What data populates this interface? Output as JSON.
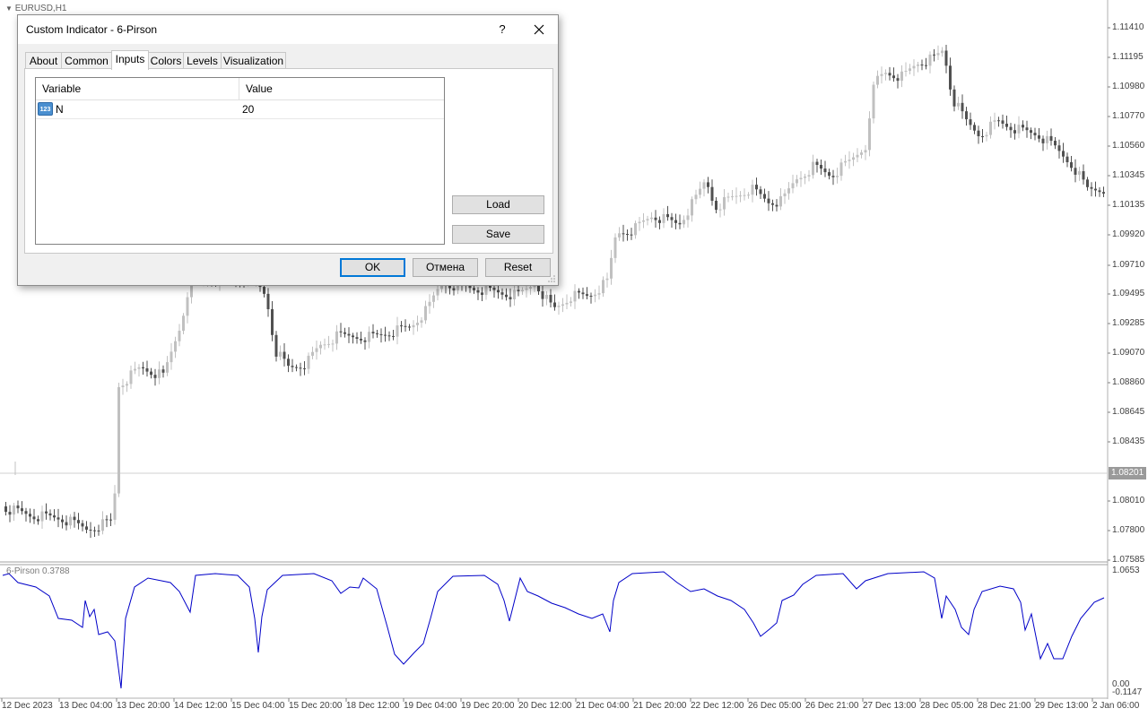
{
  "chart": {
    "symbol_label": "EURUSD,H1",
    "indicator_label": "6-Pirson 0.3788",
    "current_price": "1.08201",
    "price_axis": [
      "1.11410",
      "1.11195",
      "1.10980",
      "1.10770",
      "1.10560",
      "1.10345",
      "1.10135",
      "1.09920",
      "1.09710",
      "1.09495",
      "1.09285",
      "1.09070",
      "1.08860",
      "1.08645",
      "1.08435",
      "1.08010",
      "1.07800",
      "1.07585"
    ],
    "indicator_axis": [
      "1.0653",
      "0.00",
      "-0.1147"
    ],
    "time_axis": [
      "12 Dec 2023",
      "13 Dec 04:00",
      "13 Dec 20:00",
      "14 Dec 12:00",
      "15 Dec 04:00",
      "15 Dec 20:00",
      "18 Dec 12:00",
      "19 Dec 04:00",
      "19 Dec 20:00",
      "20 Dec 12:00",
      "21 Dec 04:00",
      "21 Dec 20:00",
      "22 Dec 12:00",
      "26 Dec 05:00",
      "26 Dec 21:00",
      "27 Dec 13:00",
      "28 Dec 05:00",
      "28 Dec 21:00",
      "29 Dec 13:00",
      "2 Jan 06:00"
    ],
    "colors": {
      "bull": "#c0c0c0",
      "bear": "#505050",
      "indicator_line": "#0000c8",
      "grid": "#c8c8c8"
    }
  },
  "dialog": {
    "title": "Custom Indicator - 6-Pirson",
    "help_label": "?",
    "tabs": [
      {
        "label": "About"
      },
      {
        "label": "Common"
      },
      {
        "label": "Inputs"
      },
      {
        "label": "Colors"
      },
      {
        "label": "Levels"
      },
      {
        "label": "Visualization"
      }
    ],
    "active_tab": "Inputs",
    "inputs_table": {
      "headers": [
        "Variable",
        "Value"
      ],
      "rows": [
        {
          "icon_text": "123",
          "variable": "N",
          "value": "20"
        }
      ]
    },
    "buttons": {
      "load": "Load",
      "save": "Save",
      "ok": "OK",
      "cancel": "Отмена",
      "reset": "Reset"
    }
  }
}
